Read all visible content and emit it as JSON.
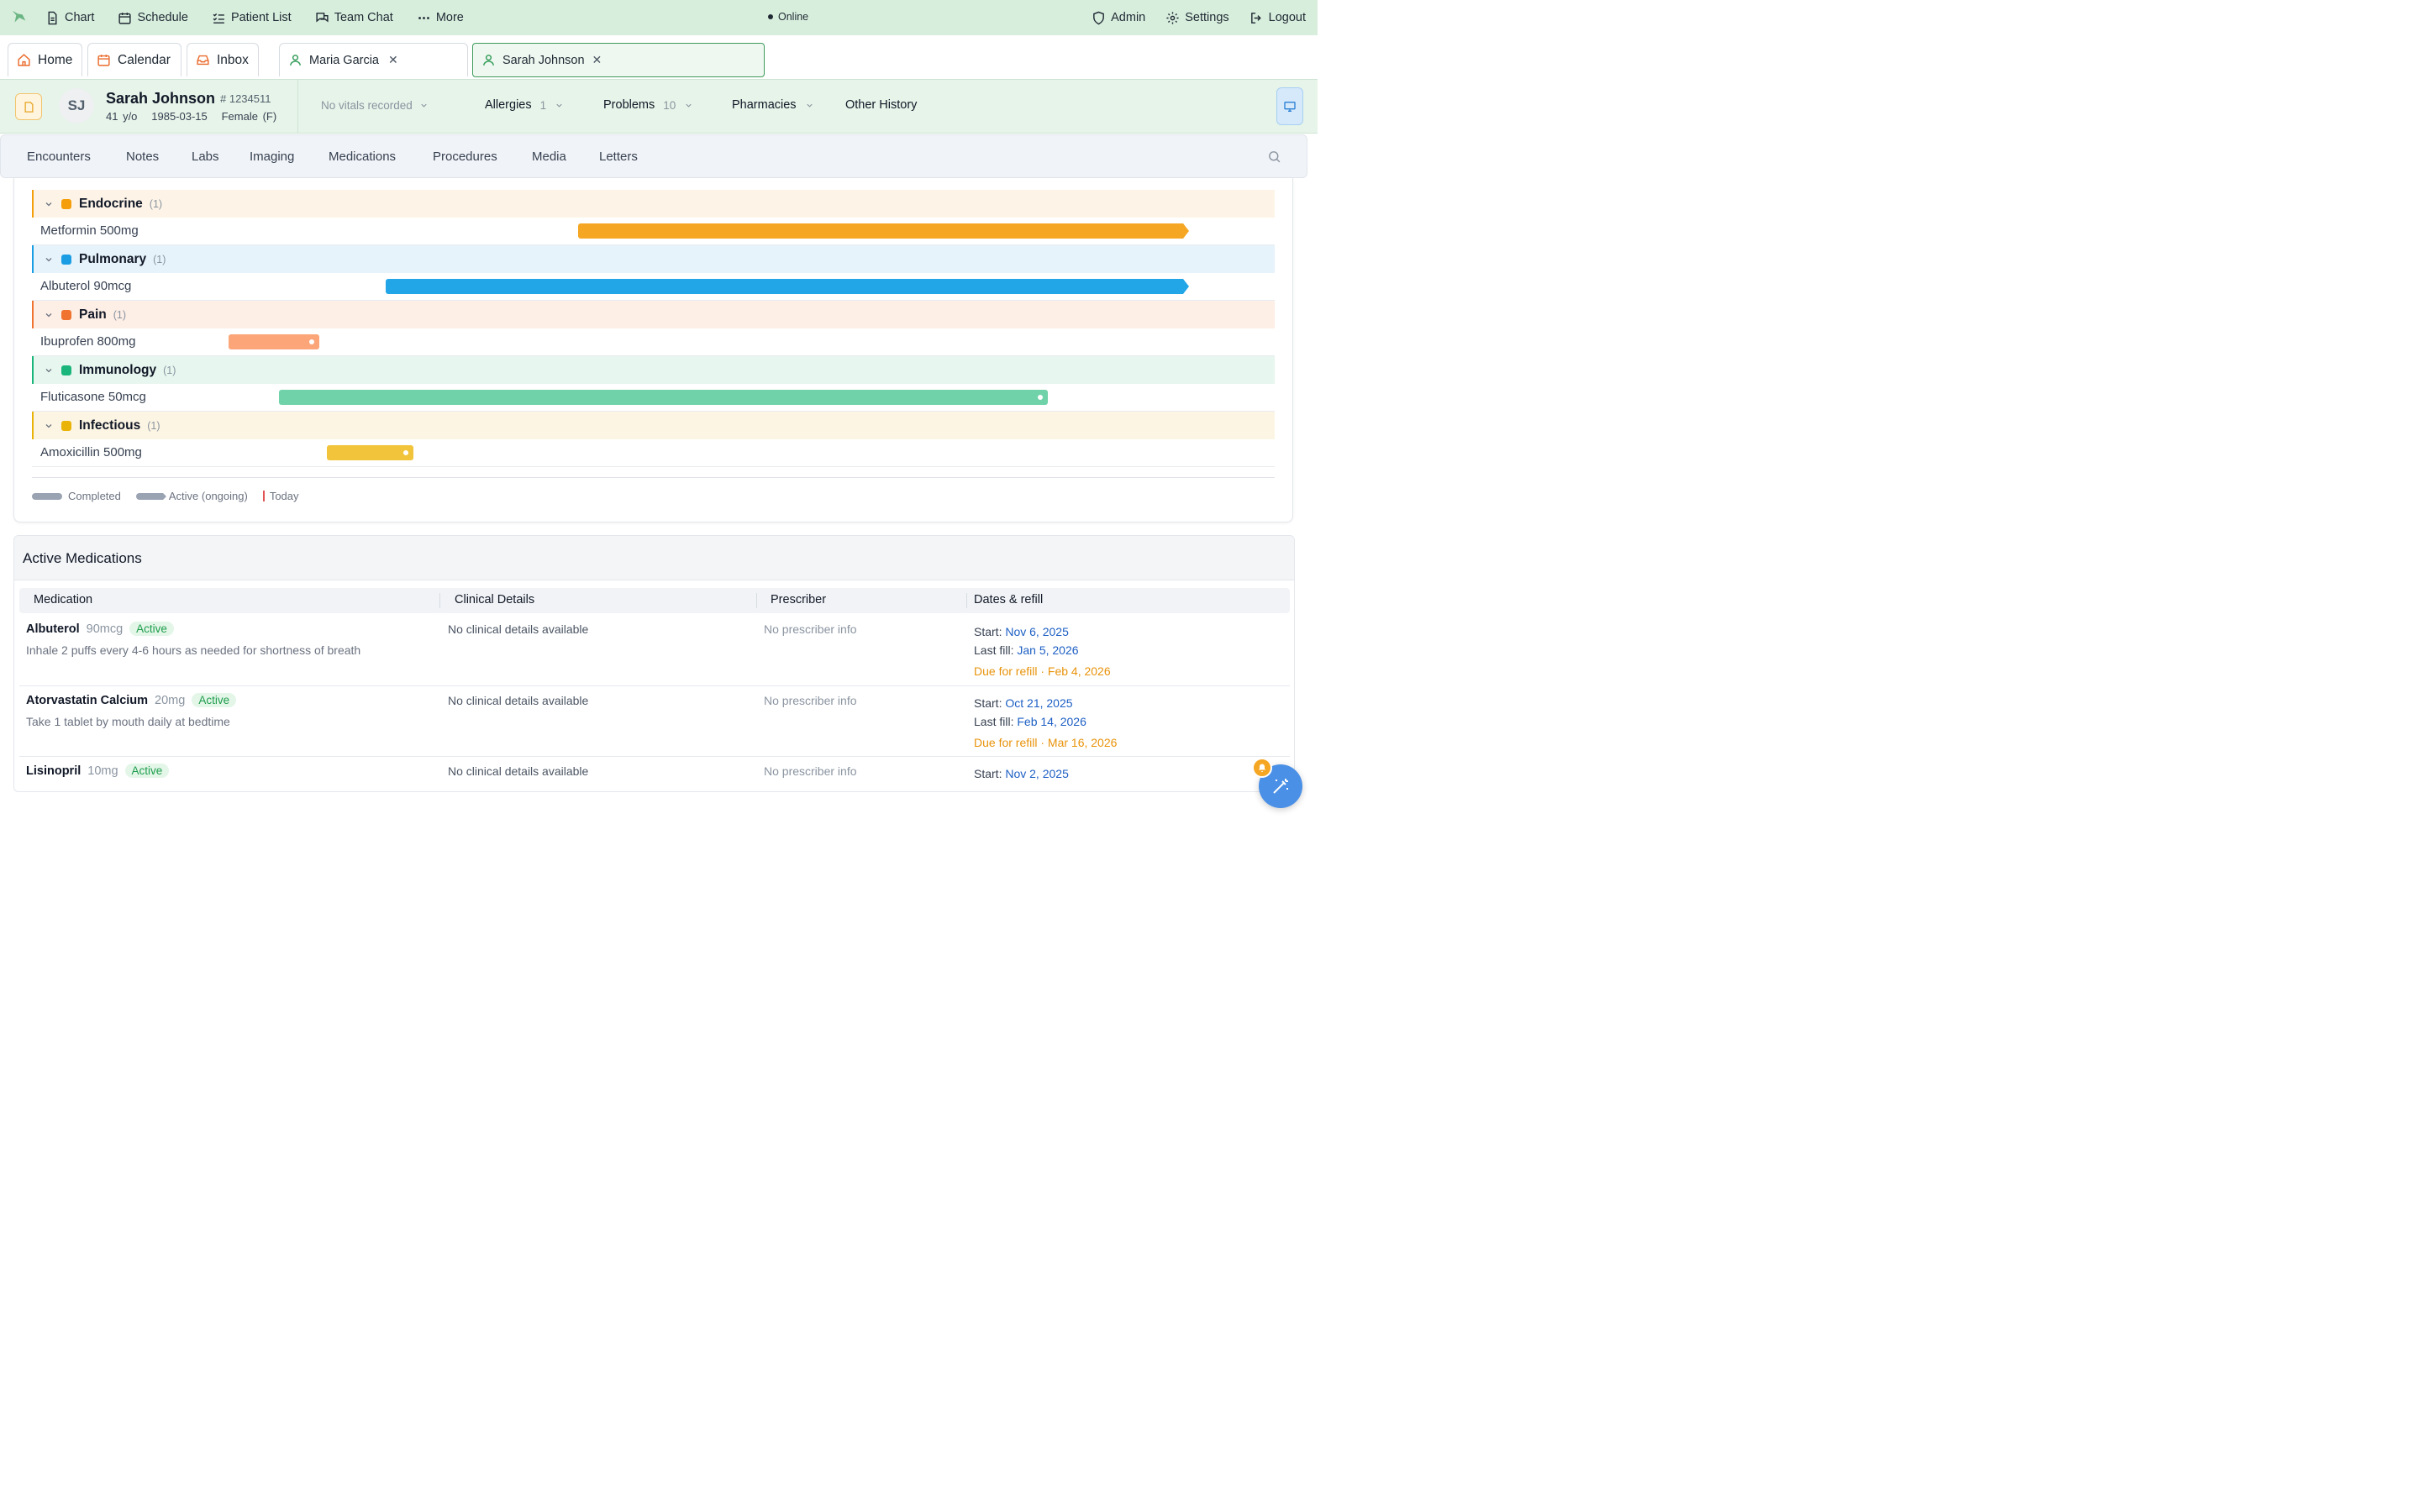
{
  "topnav": {
    "items": [
      {
        "label": "Chart",
        "icon": "document-icon"
      },
      {
        "label": "Schedule",
        "icon": "calendar-icon"
      },
      {
        "label": "Patient List",
        "icon": "checklist-icon"
      },
      {
        "label": "Team Chat",
        "icon": "chat-icon"
      },
      {
        "label": "More",
        "icon": "dots-icon"
      }
    ],
    "status": "Online",
    "right": [
      {
        "label": "Admin",
        "icon": "shield-icon"
      },
      {
        "label": "Settings",
        "icon": "gear-icon"
      },
      {
        "label": "Logout",
        "icon": "logout-icon"
      }
    ]
  },
  "tabs": {
    "home": "Home",
    "calendar": "Calendar",
    "inbox": "Inbox",
    "patient1": "Maria Garcia",
    "patient2": "Sarah Johnson",
    "close": "✕"
  },
  "patient": {
    "initials": "SJ",
    "name": "Sarah Johnson",
    "mrn": "# 1234511",
    "age": "41 y/o",
    "dob": "1985-03-15",
    "sex": "Female (F)",
    "vitals": "No vitals recorded",
    "allergies_label": "Allergies",
    "allergies_count": "1",
    "problems_label": "Problems",
    "problems_count": "10",
    "pharmacies_label": "Pharmacies",
    "other_history_label": "Other History"
  },
  "subnav": [
    "Encounters",
    "Notes",
    "Labs",
    "Imaging",
    "Medications",
    "Procedures",
    "Media",
    "Letters"
  ],
  "timeline": {
    "groups": [
      {
        "name": "Endocrine",
        "count": "(1)",
        "color": "#f59e0b",
        "bg": "#fdf4e7",
        "med": "Metformin 500mg",
        "bar_color": "#f5a623",
        "start": 0.4395,
        "end": 0.9265,
        "ongoing": true
      },
      {
        "name": "Pulmonary",
        "count": "(1)",
        "color": "#1a9de2",
        "bg": "#e6f3fb",
        "med": "Albuterol 90mcg",
        "bar_color": "#23a6e8",
        "start": 0.2846,
        "end": 0.9265,
        "ongoing": true
      },
      {
        "name": "Pain",
        "count": "(1)",
        "color": "#f0732f",
        "bg": "#fdeee6",
        "med": "Ibuprofen 800mg",
        "bar_color": "#fba579",
        "start": 0.1582,
        "end": 0.2313,
        "ongoing": false
      },
      {
        "name": "Immunology",
        "count": "(1)",
        "color": "#1ab57a",
        "bg": "#e7f6ee",
        "med": "Fluticasone 50mcg",
        "bar_color": "#6fd2a8",
        "start": 0.1988,
        "end": 0.8175,
        "ongoing": false
      },
      {
        "name": "Infectious",
        "count": "(1)",
        "color": "#eab308",
        "bg": "#fdf5e3",
        "med": "Amoxicillin 500mg",
        "bar_color": "#f2c43b",
        "start": 0.2373,
        "end": 0.3069,
        "ongoing": false
      }
    ],
    "legend_completed": "Completed",
    "legend_active": "Active (ongoing)",
    "legend_today": "Today"
  },
  "active_meds": {
    "title": "Active Medications",
    "columns": [
      "Medication",
      "Clinical Details",
      "Prescriber",
      "Dates & refill"
    ],
    "rows": [
      {
        "name": "Albuterol",
        "dose": "90mcg",
        "status": "Active",
        "sig": "Inhale 2 puffs every 4-6 hours as needed for shortness of breath",
        "clinical": "No clinical details available",
        "prescriber": "No prescriber info",
        "start_label": "Start:",
        "start": "Nov 6, 2025",
        "fill_label": "Last fill:",
        "fill": "Jan 5, 2026",
        "due": "Due for refill · Feb 4, 2026"
      },
      {
        "name": "Atorvastatin Calcium",
        "dose": "20mg",
        "status": "Active",
        "sig": "Take 1 tablet by mouth daily at bedtime",
        "clinical": "No clinical details available",
        "prescriber": "No prescriber info",
        "start_label": "Start:",
        "start": "Oct 21, 2025",
        "fill_label": "Last fill:",
        "fill": "Feb 14, 2026",
        "due": "Due for refill · Mar 16, 2026"
      },
      {
        "name": "Lisinopril",
        "dose": "10mg",
        "status": "Active",
        "sig": "",
        "clinical": "No clinical details available",
        "prescriber": "No prescriber info",
        "start_label": "Start:",
        "start": "Nov 2, 2025",
        "fill_label": "",
        "fill": "",
        "due": ""
      }
    ]
  }
}
